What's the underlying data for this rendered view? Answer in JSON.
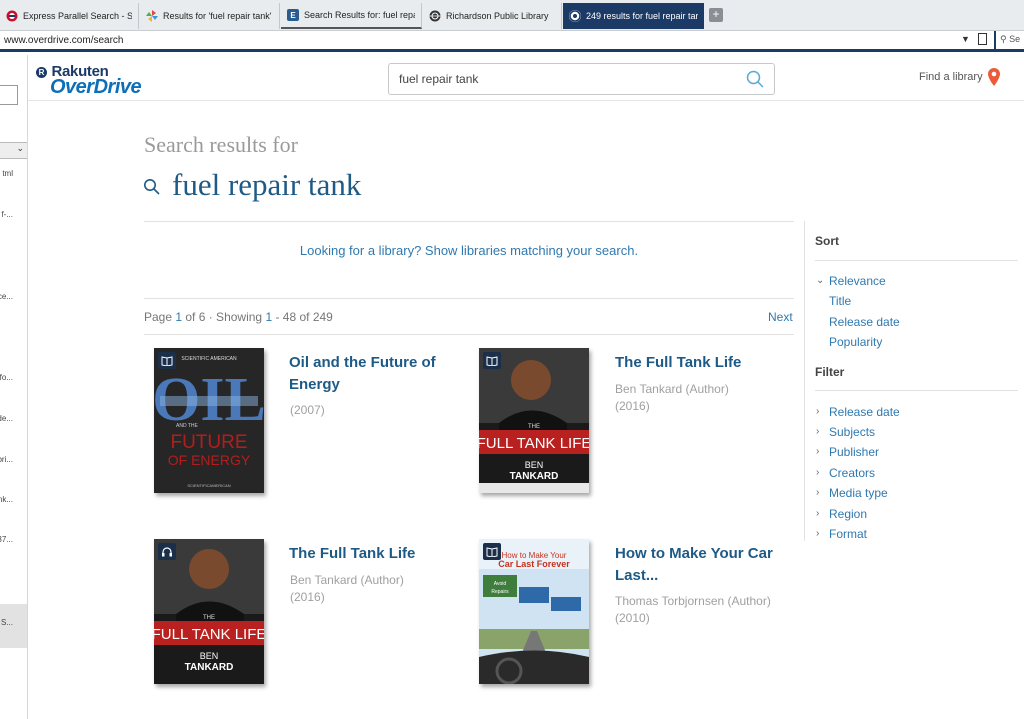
{
  "browser": {
    "tabs": [
      {
        "label": "Express Parallel Search - Sea",
        "icon": "express-icon"
      },
      {
        "label": "Results for 'fuel repair tank' |",
        "icon": "pinwheel-icon"
      },
      {
        "label": "Search Results for: fuel repa",
        "icon": "e-icon"
      },
      {
        "label": "Richardson Public Library",
        "icon": "globe-icon"
      },
      {
        "label": "249 results for fuel repair tar",
        "icon": "overdrive-icon"
      }
    ],
    "url": "www.overdrive.com/search",
    "search_placeholder": "Se"
  },
  "left_strip": {
    "items": [
      "tml",
      "f-...",
      "ce...",
      "-fo...",
      "de...",
      "bri...",
      "nk...",
      "37...",
      "S..."
    ]
  },
  "header": {
    "logo_top": "Rakuten",
    "logo_r": "R",
    "logo_bottom": "OverDrive",
    "search_value": "fuel repair tank",
    "find_library": "Find a library"
  },
  "results": {
    "heading_small": "Search results for",
    "heading_query": "fuel repair tank",
    "library_prompt": "Looking for a library? Show libraries matching your search.",
    "page_label": "Page ",
    "page_current": "1",
    "page_of": " of 6 · Showing ",
    "showing_start": "1",
    "showing_rest": " - 48 of 249",
    "next": "Next",
    "items": [
      {
        "title_1": "Oil and the Future of",
        "title_2": "Energy",
        "author": "",
        "year": "(2007)",
        "format": "ebook",
        "cover": {
          "top": "SCIENTIFIC AMERICAN",
          "big": "OIL",
          "and": "AND THE",
          "sub1": "FUTURE",
          "sub2": "OF ENERGY",
          "foot": "SCIENTIFICAMERICAN"
        }
      },
      {
        "title_1": "The Full Tank Life",
        "title_2": "",
        "author": "Ben Tankard (Author)",
        "year": "(2016)",
        "format": "ebook",
        "cover": {
          "top": "THE",
          "big": "FULL TANK LIFE",
          "sub1": "BEN",
          "sub2": "TANKARD"
        }
      },
      {
        "title_1": "The Full Tank Life",
        "title_2": "",
        "author": "Ben Tankard (Author)",
        "year": "(2016)",
        "format": "audiobook",
        "cover": {
          "top": "THE",
          "big": "FULL TANK LIFE",
          "sub1": "BEN",
          "sub2": "TANKARD"
        }
      },
      {
        "title_1": "How to Make Your Car",
        "title_2": "Last...",
        "author": "Thomas Torbjornsen (Author)",
        "year": "(2010)",
        "format": "ebook",
        "cover": {
          "top": "How to Make Your",
          "big": "Car Last Forever",
          "sub1": "Avoid Expensive Repairs",
          "sub2": "Improve Fuel Economy"
        }
      }
    ]
  },
  "sidebar": {
    "sort_label": "Sort",
    "sort_options": [
      "Relevance",
      "Title",
      "Release date",
      "Popularity"
    ],
    "filter_label": "Filter",
    "filter_options": [
      "Release date",
      "Subjects",
      "Publisher",
      "Creators",
      "Media type",
      "Region",
      "Format"
    ]
  }
}
